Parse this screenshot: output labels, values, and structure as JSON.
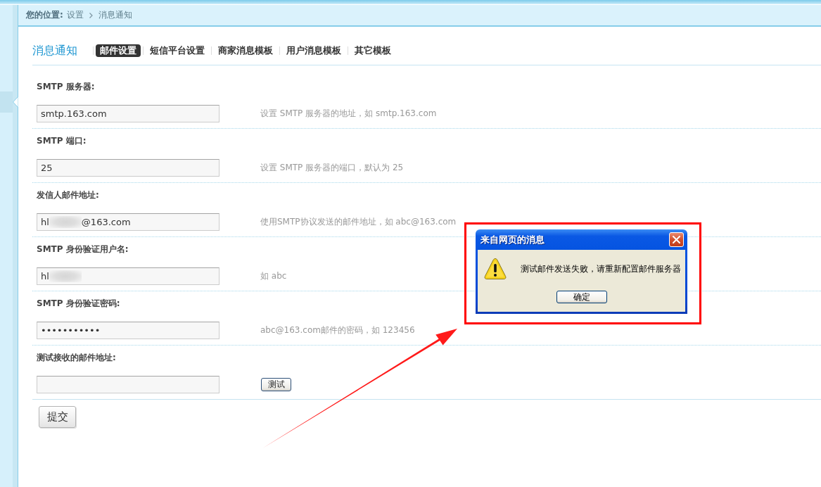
{
  "breadcrumb": {
    "label": "您的位置:",
    "items": [
      "设置",
      "消息通知"
    ]
  },
  "page_title": "消息通知",
  "tabs": [
    {
      "label": "邮件设置",
      "selected": true
    },
    {
      "label": "短信平台设置",
      "selected": false
    },
    {
      "label": "商家消息模板",
      "selected": false
    },
    {
      "label": "用户消息模板",
      "selected": false
    },
    {
      "label": "其它模板",
      "selected": false
    }
  ],
  "form": {
    "rows": [
      {
        "kind": "hint",
        "label": "SMTP 服务器:",
        "field": {
          "value": "smtp.163.com",
          "redacted": false
        },
        "hint": "设置 SMTP 服务器的地址，如 smtp.163.com"
      },
      {
        "kind": "hint",
        "label": "SMTP 端口:",
        "field": {
          "value": "25",
          "redacted": false
        },
        "hint": "设置 SMTP 服务器的端口，默认为 25"
      },
      {
        "kind": "hint",
        "label": "发信人邮件地址:",
        "field": {
          "value": "hl",
          "redacted": true,
          "value_after_redaction": "@163.com"
        },
        "hint": "使用SMTP协议发送的邮件地址，如 abc@163.com"
      },
      {
        "kind": "hint",
        "label": "SMTP 身份验证用户名:",
        "field": {
          "value": "hl",
          "redacted": true
        },
        "hint": "如 abc"
      },
      {
        "kind": "hint",
        "label": "SMTP 身份验证密码:",
        "field": {
          "value": "•••••••••••",
          "redacted": false
        },
        "hint": "abc@163.com邮件的密码，如 123456"
      },
      {
        "kind": "button",
        "label": "测试接收的邮件地址:",
        "field": {
          "redacted": false
        },
        "button": "测试"
      }
    ],
    "submit": "提交"
  },
  "dialog": {
    "title": "来自网页的消息",
    "message": "测试邮件发送失败，请重新配置邮件服务器",
    "button": "确定"
  }
}
